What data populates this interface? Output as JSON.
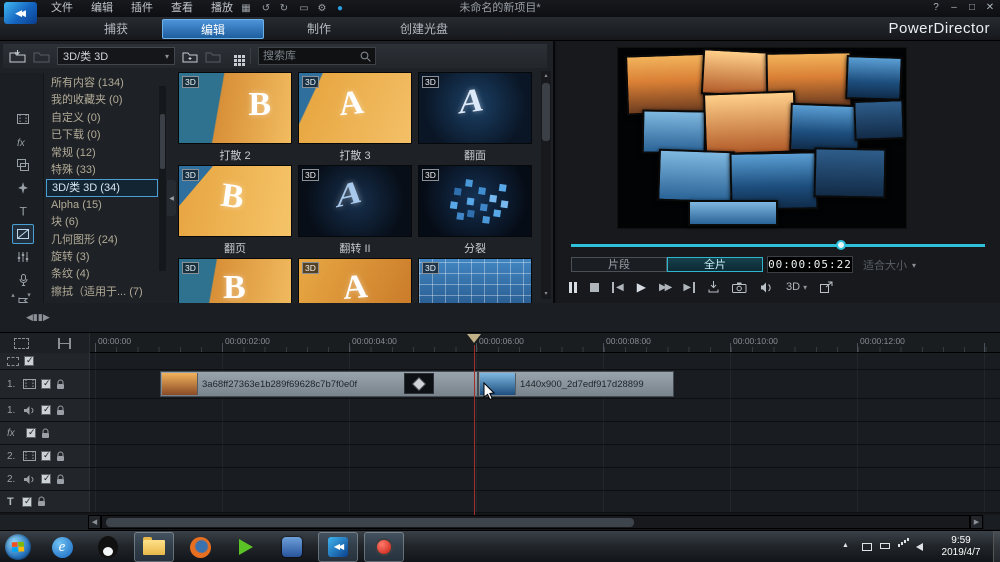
{
  "menubar": {
    "menus": [
      {
        "label": "文件"
      },
      {
        "label": "编辑"
      },
      {
        "label": "插件"
      },
      {
        "label": "查看"
      },
      {
        "label": "播放"
      }
    ],
    "title": "未命名的新项目*",
    "window": {
      "help": "?",
      "minimize": "–",
      "maximize": "□",
      "close": "✕"
    }
  },
  "tabbar": {
    "tabs": [
      {
        "label": "捕获"
      },
      {
        "label": "编辑"
      },
      {
        "label": "制作"
      },
      {
        "label": "创建光盘"
      }
    ],
    "brand": "PowerDirector"
  },
  "library": {
    "filter_value": "3D/类 3D",
    "search_placeholder": "搜索库",
    "categories": [
      {
        "label": "所有内容 (134)"
      },
      {
        "label": "我的收藏夹 (0)"
      },
      {
        "label": "自定义 (0)"
      },
      {
        "label": "已下载 (0)"
      },
      {
        "label": "常规 (12)"
      },
      {
        "label": "特殊 (33)"
      },
      {
        "label": "3D/类 3D (34)"
      },
      {
        "label": "Alpha (15)"
      },
      {
        "label": "块 (6)"
      },
      {
        "label": "几何图形 (24)"
      },
      {
        "label": "旋转 (3)"
      },
      {
        "label": "条纹 (4)"
      },
      {
        "label": "擦拭（适用于... (7)"
      }
    ],
    "items": [
      {
        "label": "打散 2",
        "badge": "3D",
        "letter": "B"
      },
      {
        "label": "打散 3",
        "badge": "3D",
        "letter": "A"
      },
      {
        "label": "翻面",
        "badge": "3D",
        "letter": "A"
      },
      {
        "label": "翻页",
        "badge": "3D",
        "letter": "B"
      },
      {
        "label": "翻转 II",
        "badge": "3D",
        "letter": "A"
      },
      {
        "label": "分裂",
        "badge": "3D",
        "letter": ""
      },
      {
        "label": "",
        "badge": "3D",
        "letter": "B"
      },
      {
        "label": "",
        "badge": "3D",
        "letter": "A"
      },
      {
        "label": "",
        "badge": "3D",
        "letter": ""
      }
    ]
  },
  "preview": {
    "segment_label": "片段",
    "movie_label": "全片",
    "timecode": "00:00:05:22",
    "fit_label": "适合大小",
    "threed_label": "3D"
  },
  "timeline": {
    "ruler": [
      "00:00:00",
      "00:00:02:00",
      "00:00:04:00",
      "00:00:06:00",
      "00:00:08:00",
      "00:00:10:00",
      "00:00:12:00"
    ],
    "tracks": [
      {
        "label": ""
      },
      {
        "label": "1."
      },
      {
        "label": "1."
      },
      {
        "label": "fx"
      },
      {
        "label": "2."
      },
      {
        "label": "2."
      },
      {
        "label": "T"
      }
    ],
    "clips": [
      {
        "name": "3a68ff27363e1b289f69628c7b7f0e0f"
      },
      {
        "name": "1440x900_2d7edf917d28899"
      }
    ]
  },
  "taskbar": {
    "time": "9:59",
    "date": "2019/4/7"
  }
}
